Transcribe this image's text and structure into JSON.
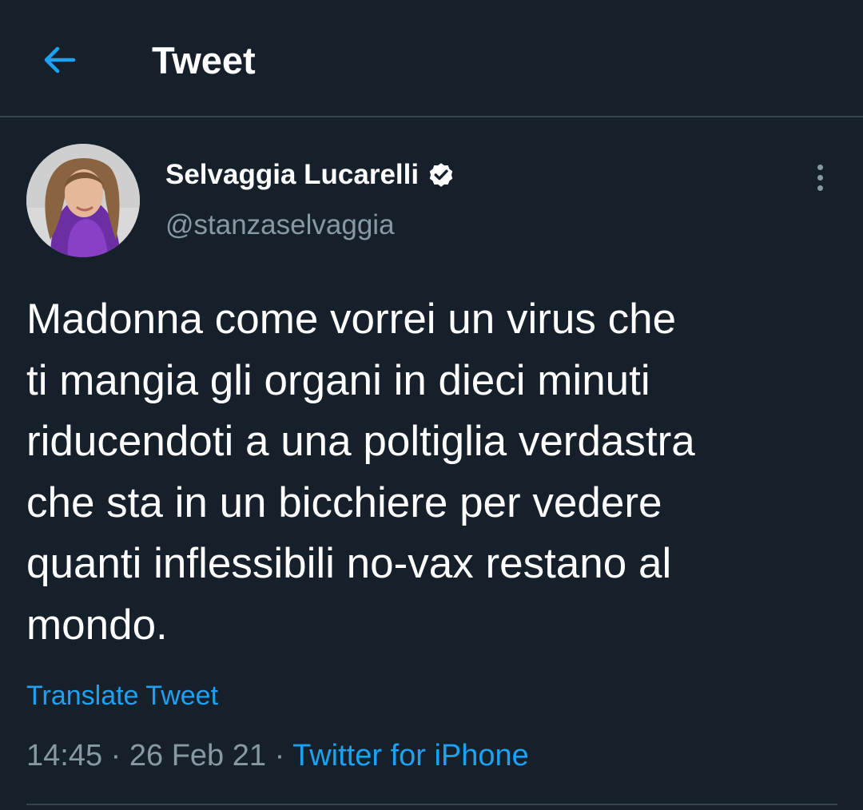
{
  "header": {
    "back_icon": "arrow-left-icon",
    "title": "Tweet"
  },
  "tweet": {
    "author": {
      "display_name": "Selvaggia Lucarelli",
      "handle": "@stanzaselvaggia",
      "verified": true,
      "verified_icon": "verified-badge-icon",
      "avatar_icon": "avatar-photo"
    },
    "more_icon": "more-vertical-icon",
    "text": "Madonna come vorrei un virus che\nti mangia gli organi in dieci minuti\nriducendoti a una poltiglia verdastra\nche sta in un bicchiere per vedere\nquanti inflessibili no-vax restano al\nmondo.",
    "translate_label": "Translate Tweet",
    "time": "14:45",
    "separator": "·",
    "date": "26 Feb 21",
    "source": "Twitter for iPhone"
  },
  "colors": {
    "background": "#15202b",
    "accent": "#1da1f2",
    "secondary_text": "#8899a6",
    "divider": "#38444d"
  }
}
